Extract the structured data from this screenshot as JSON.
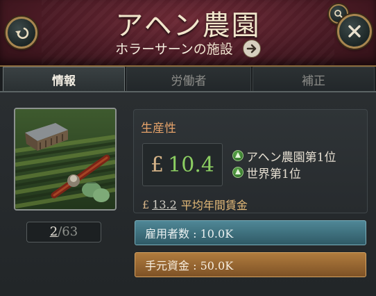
{
  "header": {
    "title": "アヘン農園",
    "subtitle_prefix": "ホラーサーン",
    "subtitle_suffix": "の施設"
  },
  "tabs": [
    {
      "label": "情報",
      "active": true
    },
    {
      "label": "労働者",
      "active": false
    },
    {
      "label": "補正",
      "active": false
    }
  ],
  "building": {
    "count_current": "2",
    "count_total": "/63"
  },
  "productivity": {
    "label": "生産性",
    "currency": "£",
    "value": "10.4",
    "ranks": [
      "アヘン農園第1位",
      "世界第1位"
    ],
    "wage_currency": "£",
    "wage_value": "13.2",
    "wage_label": "平均年間賃金"
  },
  "bars": {
    "employees": "雇用者数 : 10.0K",
    "cash": "手元資金 : 50.0K"
  },
  "colors": {
    "header_bg": "#4a1a24",
    "productivity_value": "#8ccf62",
    "productivity_label": "#e6a36a",
    "employee_bar": "#3f7380",
    "cash_bar": "#9a6a34"
  },
  "icons": [
    "back-arrow-icon",
    "close-icon",
    "search-icon",
    "right-arrow-icon",
    "rank-up-icon"
  ]
}
